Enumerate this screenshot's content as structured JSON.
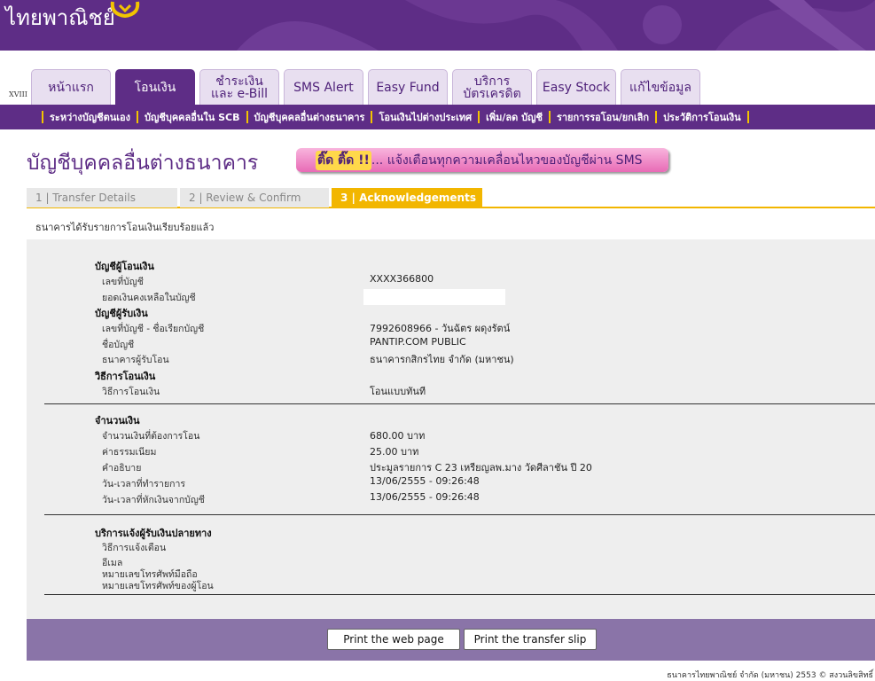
{
  "header": {
    "logo_text": "ไทยพาณิชย์"
  },
  "version": "XVIII",
  "tabs": [
    {
      "label": "หน้าแรก"
    },
    {
      "label": "โอนเงิน"
    },
    {
      "label": "ชำระเงิน",
      "label2": "และ e-Bill"
    },
    {
      "label": "SMS Alert"
    },
    {
      "label": "Easy Fund"
    },
    {
      "label": "บริการ",
      "label2": "บัตรเครดิต"
    },
    {
      "label": "Easy Stock"
    },
    {
      "label": "แก้ไขข้อมูล"
    }
  ],
  "submenu": [
    "ระหว่างบัญชีตนเอง",
    "บัญชีบุคคลอื่นใน SCB",
    "บัญชีบุคคลอื่นต่างธนาคาร",
    "โอนเงินไปต่างประเทศ",
    "เพิ่ม/ลด บัญชี",
    "รายการรอโอน/ยกเลิก",
    "ประวัติการโอนเงิน"
  ],
  "page_title": "บัญชีบุคคลอื่นต่างธนาคาร",
  "sms_banner": {
    "highlight": "ติ๊ด ติ๊ด !!",
    "text": "... แจ้งเตือนทุกความเคลื่อนไหวของบัญชีผ่าน SMS"
  },
  "steps": [
    "1 | Transfer Details",
    "2 | Review & Confirm",
    "3 | Acknowledgements"
  ],
  "confirm_message": "ธนาคารได้รับรายการโอนเงินเรียบร้อยแล้ว",
  "from_account": {
    "heading": "บัญชีผู้โอนเงิน",
    "account_no_label": "เลขที่บัญชี",
    "account_no": "XXXX366800",
    "balance_label": "ยอดเงินคงเหลือในบัญชี"
  },
  "to_account": {
    "heading": "บัญชีผู้รับเงิน",
    "account_label": "เลขที่บัญชี - ชื่อเรียกบัญชี",
    "account": "7992608966 - วันฉัตร ผดุงรัตน์",
    "name_label": "ชื่อบัญชี",
    "name": "PANTIP.COM PUBLIC",
    "bank_label": "ธนาคารผู้รับโอน",
    "bank": "ธนาคารกสิกรไทย จำกัด (มหาชน)"
  },
  "method": {
    "heading": "วิธีการโอนเงิน",
    "label": "วิธีการโอนเงิน",
    "value": "โอนแบบทันที"
  },
  "amount": {
    "heading": "จำนวนเงิน",
    "amount_label": "จำนวนเงินที่ต้องการโอน",
    "amount": "680.00 บาท",
    "fee_label": "ค่าธรรมเนียม",
    "fee": "25.00  บาท",
    "desc_label": "คำอธิบาย",
    "desc": "ประมูลรายการ C 23 เหรียญลพ.มาง วัดศีลาชัน ปี 20",
    "txn_time_label": "วัน-เวลาที่ทำรายการ",
    "txn_time": "13/06/2555 - 09:26:48",
    "debit_time_label": "วัน-เวลาที่หักเงินจากบัญชี",
    "debit_time": "13/06/2555 - 09:26:48"
  },
  "notify": {
    "heading": "บริการแจ้งผู้รับเงินปลายทาง",
    "method_label": "วิธีการแจ้งเตือน",
    "email_label": "อีเมล",
    "mobile_label": "หมายเลขโทรศัพท์มือถือ",
    "sender_mobile_label": "หมายเลขโทรศัพท์ของผู้โอน"
  },
  "buttons": {
    "print_page": "Print the web page",
    "print_slip": "Print the transfer slip"
  },
  "footer": "ธนาคารไทยพาณิชย์ จำกัด (มหาชน) 2553 © สงวนลิขสิทธิ์"
}
